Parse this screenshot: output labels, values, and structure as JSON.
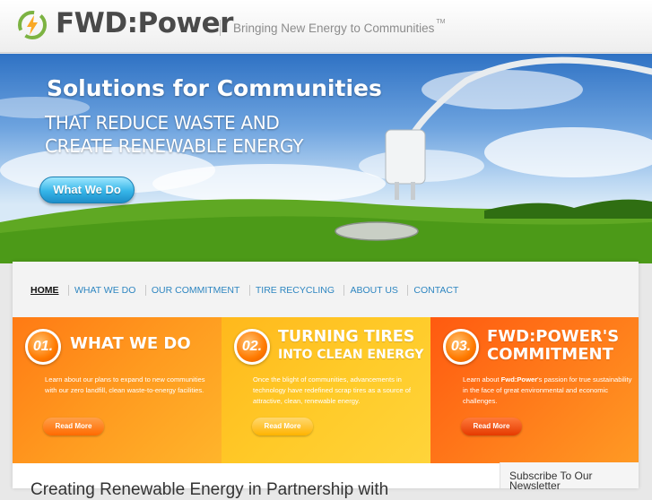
{
  "header": {
    "brand": "FWD:Power",
    "tagline": "Bringing New Energy to Communities",
    "trademark": "TM"
  },
  "hero": {
    "title": "Solutions for Communities",
    "subtitle_line1": "THAT REDUCE WASTE AND",
    "subtitle_line2": "CREATE RENEWABLE ENERGY",
    "button_label": "What We Do"
  },
  "nav": {
    "items": [
      {
        "label": "HOME"
      },
      {
        "label": "WHAT WE DO"
      },
      {
        "label": "OUR COMMITMENT"
      },
      {
        "label": "TIRE RECYCLING"
      },
      {
        "label": "ABOUT US"
      },
      {
        "label": "CONTACT"
      }
    ]
  },
  "features": [
    {
      "number": "01.",
      "title_line1": "WHAT WE DO",
      "title_line2": "",
      "text": "Learn about our plans to expand to new communities with our zero landfill, clean waste-to-energy facilities.",
      "button": "Read More"
    },
    {
      "number": "02.",
      "title_line1": "TURNING TIRES",
      "title_line2": "INTO CLEAN ENERGY",
      "text": "Once the blight of communities, advancements in technology have redefined scrap tires as a source of attractive, clean, renewable energy.",
      "button": "Read More"
    },
    {
      "number": "03.",
      "title_line1": "FWD:POWER'S",
      "title_line2": "COMMITMENT",
      "text_before": "Learn about ",
      "text_bold": "Fwd:Power",
      "text_after": "'s passion for true sustainability in the face of great environmental and economic challenges.",
      "button": "Read More"
    }
  ],
  "content": {
    "heading": "Creating Renewable Energy in Partnership with"
  },
  "sidebar": {
    "title": "Subscribe To Our Newsletter"
  },
  "colors": {
    "link_blue": "#2e86c1",
    "orange": "#ff7a14",
    "yellow": "#ffc428",
    "red_orange": "#ff5a10"
  }
}
